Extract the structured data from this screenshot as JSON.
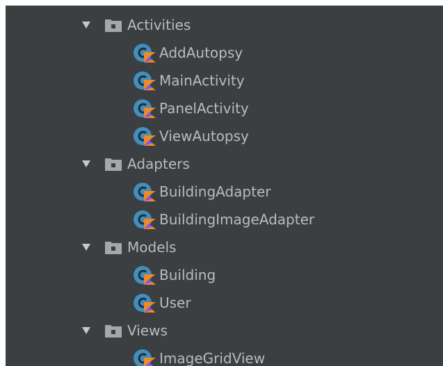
{
  "project_tree": {
    "groups": [
      {
        "folder": "Activities",
        "files": [
          "AddAutopsy",
          "MainActivity",
          "PanelActivity",
          "ViewAutopsy"
        ]
      },
      {
        "folder": "Adapters",
        "files": [
          "BuildingAdapter",
          "BuildingImageAdapter"
        ]
      },
      {
        "folder": "Models",
        "files": [
          "Building",
          "User"
        ]
      },
      {
        "folder": "Views",
        "files": [
          "ImageGridView"
        ]
      }
    ]
  },
  "icons": {
    "folder": "folder-icon",
    "expand_arrow": "chevron-down-icon",
    "kotlin_class": "kotlin-class-icon"
  },
  "colors": {
    "panel_background": "#3c3f41",
    "text": "#bbbbbb",
    "folder_icon": "#a7a7a7",
    "class_icon_circle": "#3f8fc1",
    "kotlin_orange": "#f08a24",
    "kotlin_purple": "#7f52ff"
  }
}
